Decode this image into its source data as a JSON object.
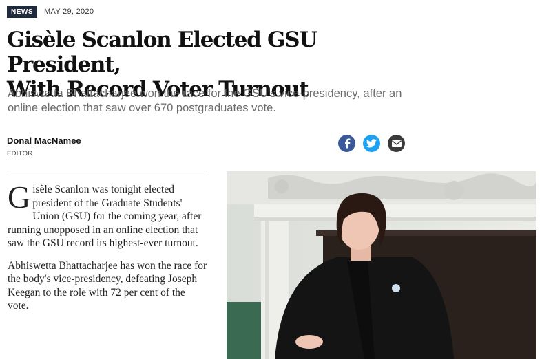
{
  "article": {
    "category": "NEWS",
    "date": "MAY 29, 2020",
    "headline_line1": "Gisèle Scanlon Elected GSU President,",
    "headline_line2": "With Record Voter Turnout",
    "subhead": "Abhiswetta Bhattacharjee won the race for the GSU's vice-presidency, after an online election that saw over 670 postgraduates vote.",
    "author": "Donal MacNamee",
    "author_role": "EDITOR",
    "dropcap": "G",
    "paragraph1_rest": "isèle Scanlon was tonight elected president of the Graduate Students' Union (GSU) for the coming year, after running unopposed in an online election that saw the GSU record its highest-ever turnout.",
    "paragraph2": "Abhiswetta Bhattacharjee has won the race for the body's vice-presidency, defeating Joseph Keegan to the role with 72 per cent of the vote."
  },
  "share": {
    "icons": [
      "facebook-icon",
      "twitter-icon",
      "email-icon"
    ]
  },
  "colors": {
    "badge_bg": "#1f2a3a",
    "facebook": "#3b5998",
    "twitter": "#1da1f2",
    "email": "#3a3a3a",
    "subhead": "#6b6b6b"
  }
}
